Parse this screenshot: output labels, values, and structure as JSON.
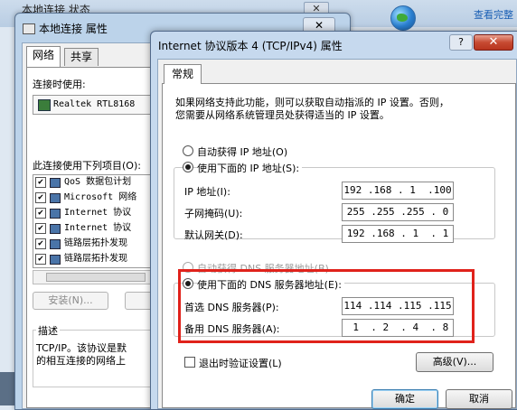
{
  "background": {
    "title": "本地连接 状态",
    "close_label": "✕",
    "link_text": "查看完整"
  },
  "props_window": {
    "title": "本地连接 属性",
    "close_label": "✕",
    "tabs": [
      "网络",
      "共享"
    ],
    "connect_using_label": "连接时使用:",
    "adapter_name": "Realtek RTL8168",
    "items_label": "此连接使用下列项目(O):",
    "components": [
      {
        "label": "QoS 数据包计划",
        "checked": true
      },
      {
        "label": "Microsoft 网络",
        "checked": true
      },
      {
        "label": "Internet 协议",
        "checked": true
      },
      {
        "label": "Internet 协议",
        "checked": true
      },
      {
        "label": "链路层拓扑发现",
        "checked": true
      },
      {
        "label": "链路层拓扑发现",
        "checked": true
      }
    ],
    "install_button": "安装(N)...",
    "description_title": "描述",
    "description_lines": [
      "TCP/IP。该协议是默",
      "的相互连接的网络上"
    ]
  },
  "tcpip_dialog": {
    "title": "Internet 协议版本 4 (TCP/IPv4) 属性",
    "help_label": "?",
    "close_label": "✕",
    "tab": "常规",
    "intro_lines": [
      "如果网络支持此功能，则可以获取自动指派的 IP 设置。否则，",
      "您需要从网络系统管理员处获得适当的 IP 设置。"
    ],
    "ip_auto_label": "自动获得 IP 地址(O)",
    "ip_manual_label": "使用下面的 IP 地址(S):",
    "ip_address_label": "IP 地址(I):",
    "ip_address": "192 .168 . 1  .100",
    "subnet_label": "子网掩码(U):",
    "subnet": "255 .255 .255 . 0",
    "gateway_label": "默认网关(D):",
    "gateway": "192 .168 . 1  . 1",
    "dns_auto_label": "自动获得 DNS 服务器地址(B)",
    "dns_manual_label": "使用下面的 DNS 服务器地址(E):",
    "dns_preferred_label": "首选 DNS 服务器(P):",
    "dns_preferred": "114 .114 .115 .115",
    "dns_alternate_label": "备用 DNS 服务器(A):",
    "dns_alternate": " 1  . 2  . 4  . 8",
    "validate_label": "退出时验证设置(L)",
    "advanced_button": "高级(V)...",
    "ok_button": "确定",
    "cancel_button": "取消"
  },
  "colors": {
    "highlight_box": "#e0221b",
    "title_bar": "#c6d9ee",
    "close_button": "#c74a32"
  }
}
